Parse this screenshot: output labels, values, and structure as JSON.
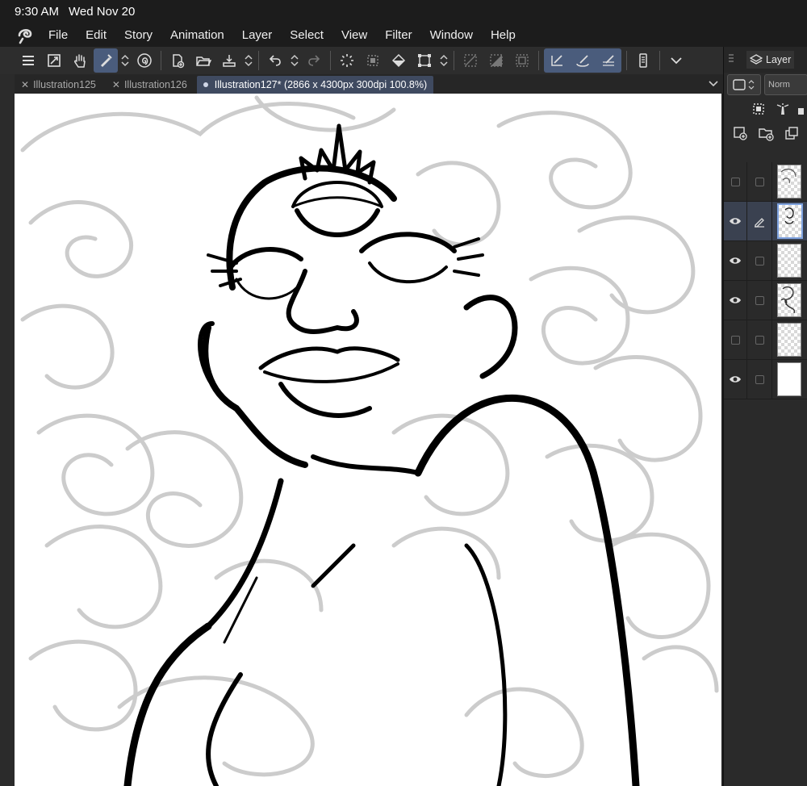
{
  "status": {
    "time": "9:30 AM",
    "date": "Wed Nov 20"
  },
  "menu": [
    "File",
    "Edit",
    "Story",
    "Animation",
    "Layer",
    "Select",
    "View",
    "Filter",
    "Window",
    "Help"
  ],
  "tabs": [
    {
      "label": "Illustration125",
      "active": false
    },
    {
      "label": "Illustration126",
      "active": false
    },
    {
      "label": "Illustration127* (2866 x 4300px 300dpi 100.8%)",
      "active": true
    }
  ],
  "layer_panel": {
    "tab_label": "Layer",
    "blend_mode": "Norm",
    "layers": [
      {
        "visible": false,
        "edit": false,
        "selected": false,
        "thumb": "sketch"
      },
      {
        "visible": true,
        "edit": true,
        "selected": true,
        "thumb": "lineart"
      },
      {
        "visible": true,
        "edit": false,
        "selected": false,
        "thumb": "empty"
      },
      {
        "visible": true,
        "edit": false,
        "selected": false,
        "thumb": "rough"
      },
      {
        "visible": false,
        "edit": false,
        "selected": false,
        "thumb": "empty"
      },
      {
        "visible": true,
        "edit": false,
        "selected": false,
        "thumb": "white"
      }
    ]
  },
  "colors": {
    "accent": "#4a5c7c",
    "selected_layer": "#3a4150",
    "toolbar": "#2d2d2d"
  }
}
